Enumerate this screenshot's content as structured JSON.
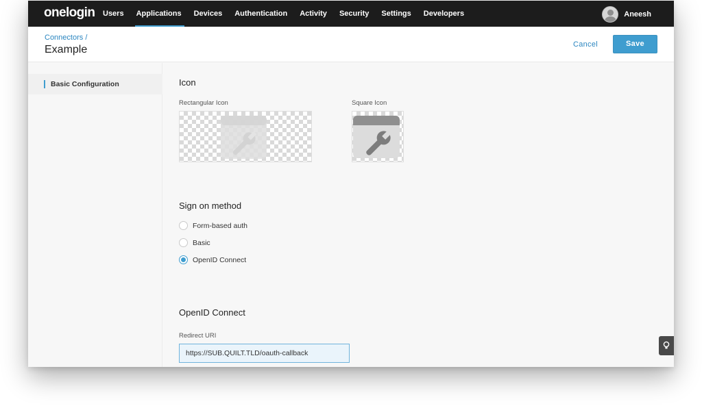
{
  "nav": {
    "brand": "onelogin",
    "items": [
      "Users",
      "Applications",
      "Devices",
      "Authentication",
      "Activity",
      "Security",
      "Settings",
      "Developers"
    ],
    "active": "Applications",
    "user_name": "Aneesh"
  },
  "header": {
    "breadcrumb": "Connectors",
    "breadcrumb_sep": "/",
    "title": "Example",
    "cancel_label": "Cancel",
    "save_label": "Save"
  },
  "sidebar": {
    "items": [
      {
        "label": "Basic Configuration",
        "active": true
      }
    ]
  },
  "icon_section": {
    "title": "Icon",
    "rect_label": "Rectangular Icon",
    "square_label": "Square Icon"
  },
  "sign_on": {
    "title": "Sign on method",
    "options": [
      {
        "label": "Form-based auth",
        "checked": false
      },
      {
        "label": "Basic",
        "checked": false
      },
      {
        "label": "OpenID Connect",
        "checked": true
      }
    ]
  },
  "oidc": {
    "title": "OpenID Connect",
    "redirect_label": "Redirect URI",
    "redirect_value": "https://SUB.QUILT.TLD/oauth-callback"
  },
  "colors": {
    "accent": "#3f9dcf",
    "nav_bg": "#1c1c1c"
  },
  "icons": [
    "wrench-icon",
    "lightbulb-icon",
    "avatar-icon"
  ]
}
